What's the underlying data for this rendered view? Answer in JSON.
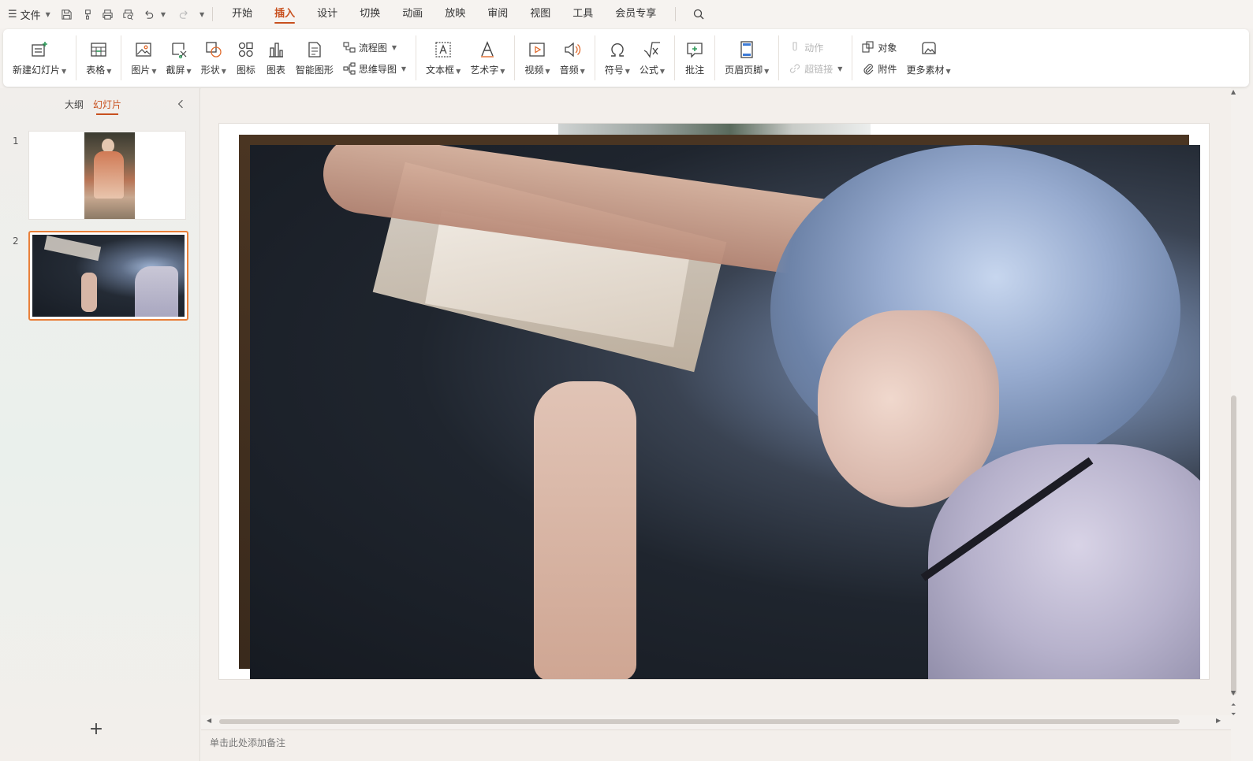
{
  "menubar": {
    "file_label": "文件",
    "tabs": [
      "开始",
      "插入",
      "设计",
      "切换",
      "动画",
      "放映",
      "审阅",
      "视图",
      "工具",
      "会员专享"
    ],
    "active_tab": "插入"
  },
  "ribbon": {
    "new_slide": "新建幻灯片",
    "table": "表格",
    "picture": "图片",
    "screenshot": "截屏",
    "shape": "形状",
    "icon": "图标",
    "chart": "图表",
    "smartart": "智能图形",
    "flowchart": "流程图",
    "mindmap": "思维导图",
    "textbox": "文本框",
    "wordart": "艺术字",
    "video": "视频",
    "audio": "音频",
    "symbol": "符号",
    "formula": "公式",
    "comment": "批注",
    "header_footer": "页眉页脚",
    "action": "动作",
    "hyperlink": "超链接",
    "object": "对象",
    "attachment": "附件",
    "more_assets": "更多素材"
  },
  "left_panel": {
    "tab_outline": "大纲",
    "tab_slides": "幻灯片",
    "slides": [
      {
        "number": "1"
      },
      {
        "number": "2"
      }
    ],
    "selected_slide": 2
  },
  "notes": {
    "placeholder": "单击此处添加备注"
  },
  "colors": {
    "accent": "#c8501e",
    "selection": "#e9803a"
  }
}
